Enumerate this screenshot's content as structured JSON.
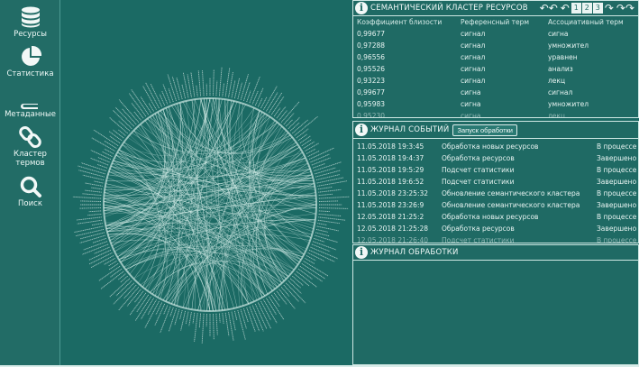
{
  "sidebar": {
    "items": [
      {
        "label": "Ресурсы",
        "icon": "database-icon"
      },
      {
        "label": "Статистика",
        "icon": "pie-chart-icon"
      },
      {
        "label": "Метаданные",
        "icon": "book-icon"
      },
      {
        "label": "Кластер термов",
        "icon": "link-icon"
      },
      {
        "label": "Поиск",
        "icon": "search-icon"
      }
    ]
  },
  "cluster_panel": {
    "title": "СЕМАНТИЧЕСКИЙ КЛАСТЕР РЕСУРСОВ",
    "pages": [
      "1",
      "2",
      "3"
    ],
    "columns": [
      "Коэффициент близости",
      "Референсный терм",
      "Ассоциативный терм"
    ],
    "rows": [
      [
        "0,99677",
        "сигнал",
        "сигна"
      ],
      [
        "0,97288",
        "сигнал",
        "умножител"
      ],
      [
        "0,96556",
        "сигнал",
        "уравнен"
      ],
      [
        "0,95526",
        "сигнал",
        "анализ"
      ],
      [
        "0,93223",
        "сигнал",
        "лекц"
      ],
      [
        "0,99677",
        "сигна",
        "сигнал"
      ],
      [
        "0,95983",
        "сигна",
        "умножител"
      ],
      [
        "0,95230",
        "сигна",
        "лекц"
      ]
    ]
  },
  "events_panel": {
    "title": "ЖУРНАЛ СОБЫТИЙ",
    "button_label": "Запуск обработки",
    "rows": [
      [
        "11.05.2018 19:3:45",
        "Обработка новых ресурсов",
        "В процессе"
      ],
      [
        "11.05.2018 19:4:37",
        "Обработка ресурсов",
        "Завершено"
      ],
      [
        "11.05.2018 19:5:29",
        "Подсчет статистики",
        "В процессе"
      ],
      [
        "11.05.2018 19:6:52",
        "Подсчет статистики",
        "Завершено"
      ],
      [
        "11.05.2018 23:25:32",
        "Обновление семантического кластера",
        "В процессе"
      ],
      [
        "11.05.2018 23:26:9",
        "Обновление семантического кластера",
        "Завершено"
      ],
      [
        "12.05.2018 21:25:2",
        "Обработка новых ресурсов",
        "В процессе"
      ],
      [
        "12.05.2018 21:25:28",
        "Обработка ресурсов",
        "Завершено"
      ],
      [
        "12.05.2018 21:26:40",
        "Подсчет статистики",
        "В процессе"
      ]
    ]
  },
  "processing_panel": {
    "title": "ЖУРНАЛ ОБРАБОТКИ"
  },
  "colors": {
    "background": "#1b6a64",
    "edge": "#cfe9e4",
    "panel_border": "#cfe8e4"
  }
}
